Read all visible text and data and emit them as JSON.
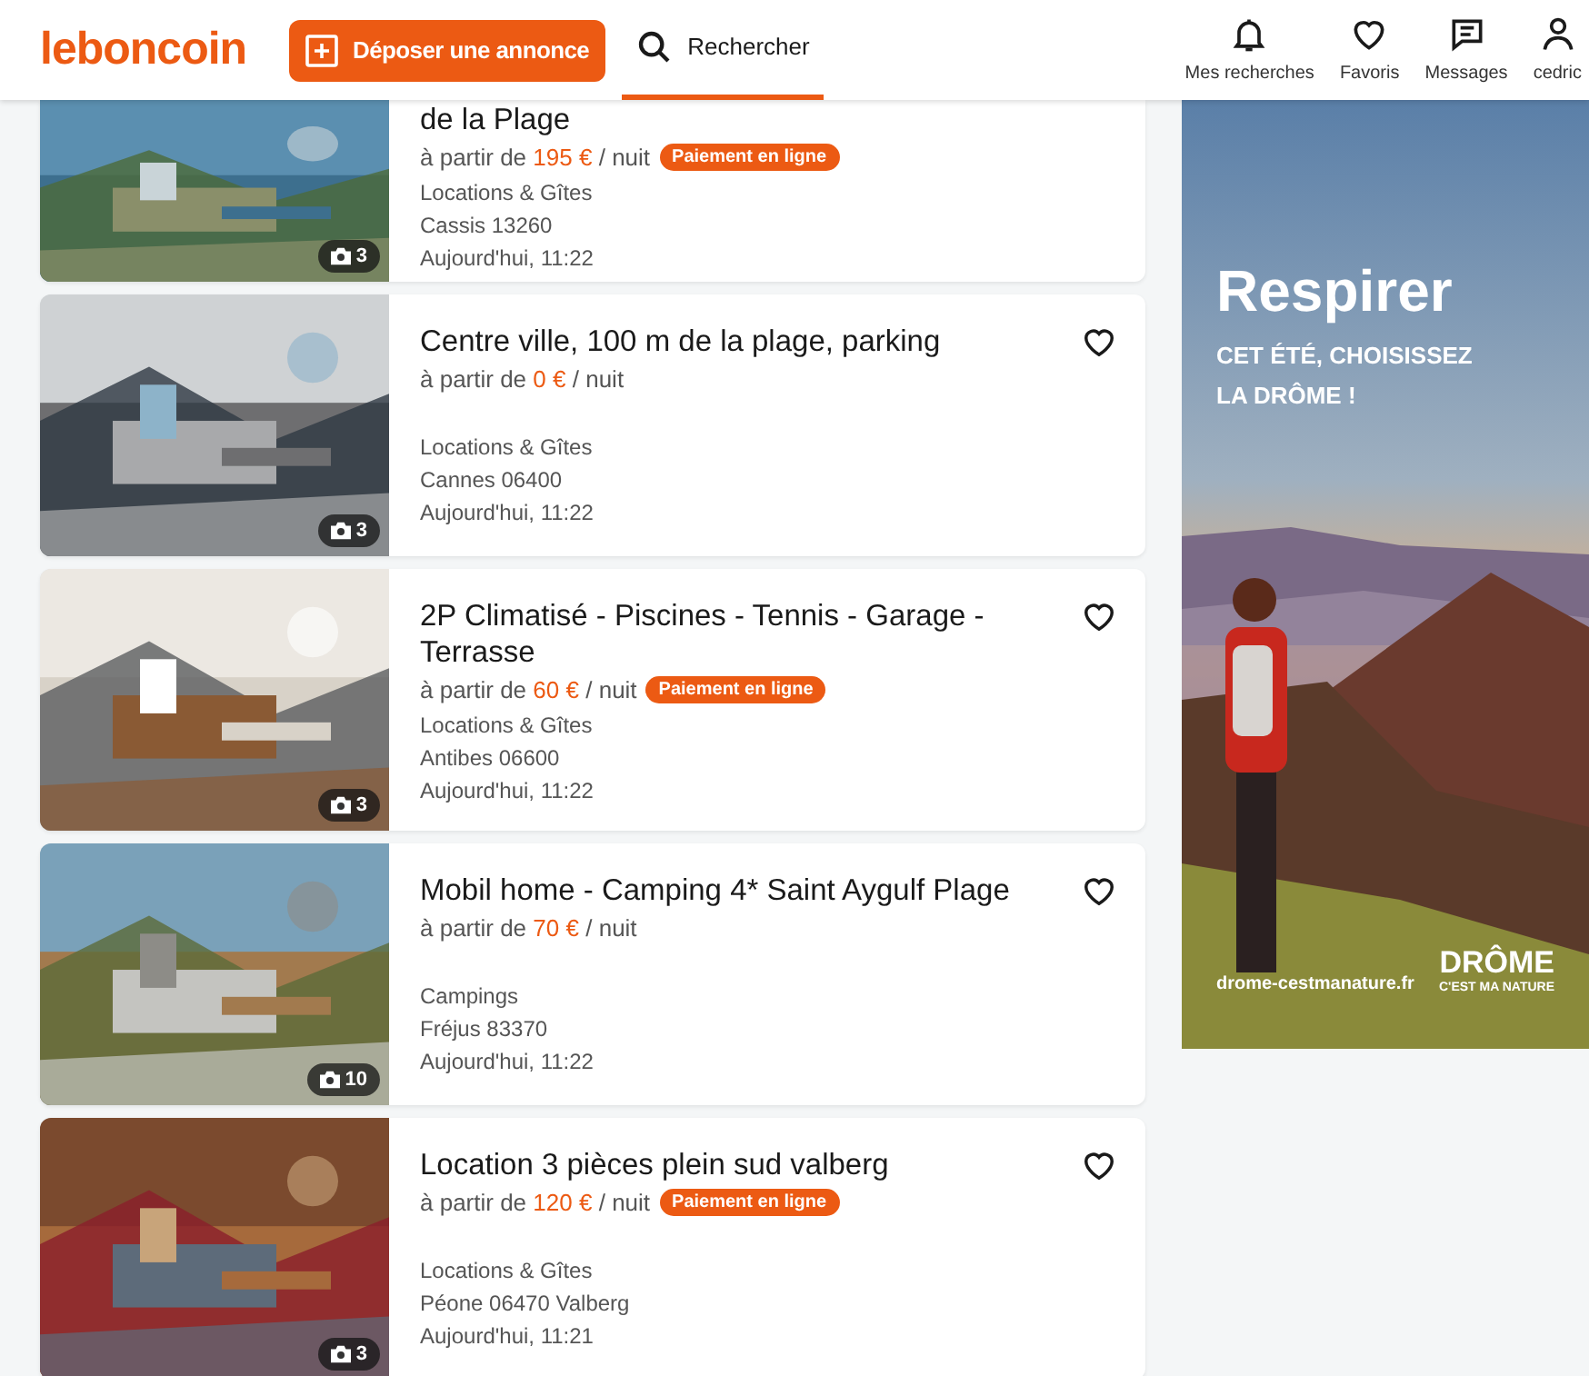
{
  "header": {
    "logo": "leboncoin",
    "post_button": "Déposer une annonce",
    "search_tab": {
      "label": "Rechercher",
      "selected": true
    },
    "nav": [
      {
        "kind": "bell",
        "label": "Mes recherches"
      },
      {
        "kind": "heart",
        "label": "Favoris"
      },
      {
        "kind": "message",
        "label": "Messages"
      },
      {
        "kind": "user",
        "label": "cedric"
      }
    ]
  },
  "listings": [
    {
      "title": "de la Plage",
      "prefix": "à partir de",
      "price": "195 €",
      "unit": "/ nuit",
      "badge": "Paiement en ligne",
      "category": "Locations & Gîtes",
      "location": "Cassis 13260",
      "date": "Aujourd'hui, 11:22",
      "photos": "3",
      "heart_visible": false
    },
    {
      "title": "Centre ville, 100 m de la plage, parking",
      "prefix": "à partir de",
      "price": "0 €",
      "unit": "/ nuit",
      "category": "Locations & Gîtes",
      "location": "Cannes 06400",
      "date": "Aujourd'hui, 11:22",
      "photos": "3",
      "heart_visible": true
    },
    {
      "title": "2P Climatisé - Piscines - Tennis - Garage - Terrasse",
      "prefix": "à partir de",
      "price": "60 €",
      "unit": "/ nuit",
      "badge": "Paiement en ligne",
      "category": "Locations & Gîtes",
      "location": "Antibes 06600",
      "date": "Aujourd'hui, 11:22",
      "photos": "3",
      "heart_visible": true
    },
    {
      "title": "Mobil home - Camping 4* Saint Aygulf Plage",
      "prefix": "à partir de",
      "price": "70 €",
      "unit": "/ nuit",
      "category": "Campings",
      "location": "Fréjus 83370",
      "date": "Aujourd'hui, 11:22",
      "photos": "10",
      "heart_visible": true
    },
    {
      "title": "Location 3 pièces plein sud valberg",
      "prefix": "à partir de",
      "price": "120 €",
      "unit": "/ nuit",
      "badge": "Paiement en ligne",
      "category": "Locations & Gîtes",
      "location": "Péone 06470 Valberg",
      "date": "Aujourd'hui, 11:21",
      "photos": "3",
      "heart_visible": true
    }
  ],
  "ad": {
    "headline": "Respirer",
    "subline": "CET ÉTÉ, CHOISISSEZ LA DRÔME !",
    "url": "drome-cestmanature.fr",
    "brand": "DRÔME",
    "brand_tagline": "C'EST MA NATURE"
  }
}
